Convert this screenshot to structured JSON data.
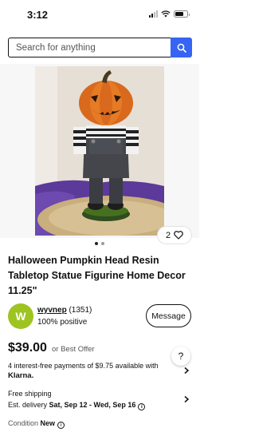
{
  "status_bar": {
    "time": "3:12"
  },
  "search": {
    "placeholder": "Search for anything"
  },
  "gallery": {
    "watch_count": "2"
  },
  "item": {
    "title": "Halloween Pumpkin Head Resin Tabletop Statue Figurine Home Decor 11.25\""
  },
  "seller": {
    "initial": "W",
    "name": "wyvnep",
    "feedback_count": "(1351)",
    "positive": "100% positive",
    "message_label": "Message"
  },
  "pricing": {
    "price": "$39.00",
    "best_offer": "or Best Offer",
    "installments": "4 interest-free payments of $9.75 available with",
    "klarna": "Klarna."
  },
  "shipping": {
    "free": "Free shipping",
    "est_label": "Est. delivery ",
    "est_dates": "Sat, Sep 12 - Wed, Sep 16"
  },
  "condition": {
    "label": "Condition",
    "value": "New"
  },
  "help": {
    "label": "?"
  },
  "colors": {
    "accent": "#3665f3",
    "avatar": "#9dc420"
  }
}
